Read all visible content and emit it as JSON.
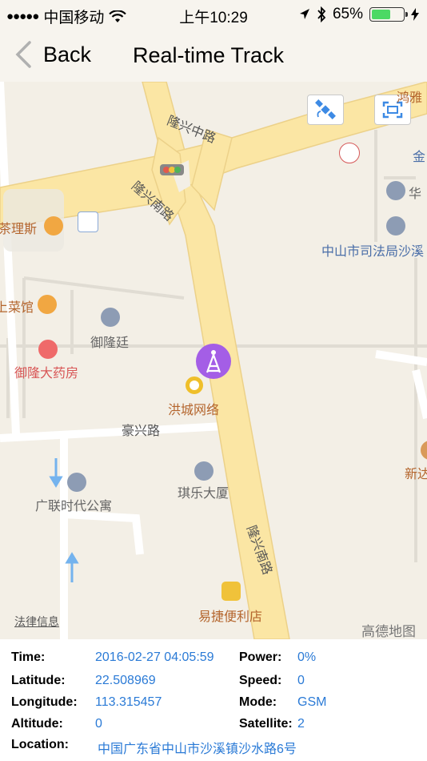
{
  "status_bar": {
    "carrier": "中国移动",
    "time": "上午10:29",
    "battery_percent": "65%",
    "battery_level": 0.65
  },
  "nav": {
    "back_label": "Back",
    "title": "Real-time Track"
  },
  "map": {
    "roads": {
      "longxing_middle": "隆兴中路",
      "longxing_south_1": "隆兴南路",
      "longxing_south_2": "隆兴南路",
      "haoxing": "豪兴路"
    },
    "pois": {
      "chalisi": "茶理斯",
      "caiguan": "上菜馆",
      "yulongting": "御隆廷",
      "pharmacy": "御隆大药房",
      "hongcheng": "洪城网络",
      "qile": "琪乐大厦",
      "guanglian": "广联时代公寓",
      "yijie": "易捷便利店",
      "court": "中山市司法局沙溪",
      "hua": "华",
      "xinda": "新达",
      "jin": "金",
      "hongya": "鸿雅",
      "legal": "法律信息",
      "gaode": "高德地图"
    },
    "colors": {
      "road": "#fbe6a4",
      "road_edge": "#ecd189",
      "background": "#f3efe6",
      "marker": "#a45ee6"
    }
  },
  "info": {
    "time_label": "Time:",
    "time_value": "2016-02-27 04:05:59",
    "power_label": "Power:",
    "power_value": "0%",
    "latitude_label": "Latitude:",
    "latitude_value": "22.508969",
    "speed_label": "Speed:",
    "speed_value": "0",
    "longitude_label": "Longitude:",
    "longitude_value": "113.315457",
    "mode_label": "Mode:",
    "mode_value": "GSM",
    "altitude_label": "Altitude:",
    "altitude_value": "0",
    "satellite_label": "Satellite:",
    "satellite_value": "2",
    "location_label": "Location:",
    "location_value": "中国广东省中山市沙溪镇沙水路6号"
  }
}
